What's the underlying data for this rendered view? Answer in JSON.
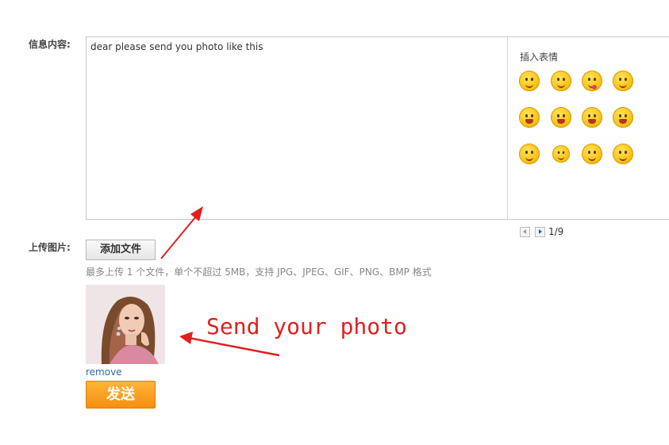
{
  "form": {
    "message_label": "信息内容:",
    "message_value": "dear please send you photo like this",
    "upload_label": "上传图片:",
    "add_file_label": "添加文件",
    "upload_hint": "最多上传 1 个文件，单个不超过 5MB，支持 JPG、JPEG、GIF、PNG、BMP 格式",
    "remove_label": "remove",
    "send_label": "发送"
  },
  "emoji_panel": {
    "title": "插入表情",
    "page_indicator": "1/9",
    "icons": [
      "smile-emoji-icon",
      "wink-emoji-icon",
      "tongue-emoji-icon",
      "giggle-emoji-icon",
      "sick-emoji-icon",
      "shout-emoji-icon",
      "laugh-tears-emoji-icon",
      "shy-emoji-icon",
      "wave-emoji-icon",
      "dizzy-emoji-icon",
      "smirk-emoji-icon",
      "think-emoji-icon"
    ]
  },
  "annotation": {
    "text": "Send your photo",
    "color": "#e02020"
  },
  "colors": {
    "accent": "#f58f0f",
    "link": "#2a6aa5"
  }
}
